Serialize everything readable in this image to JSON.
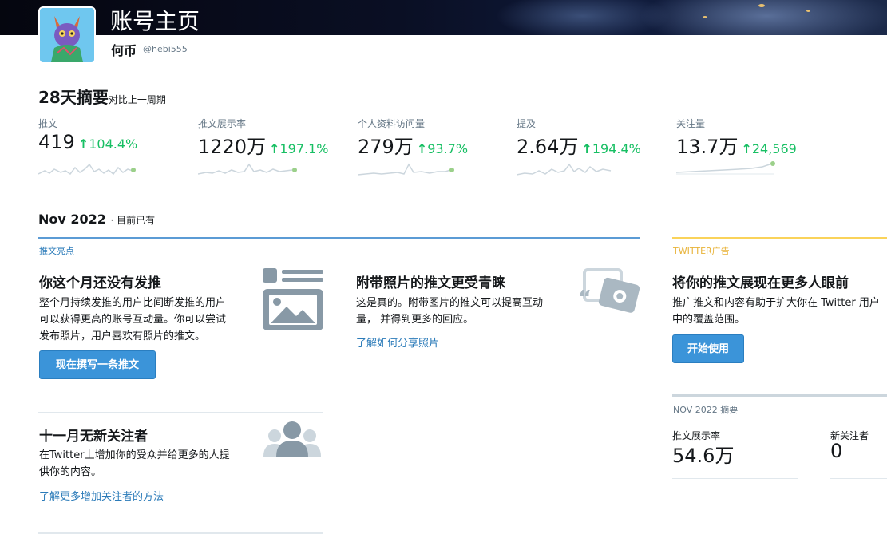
{
  "header": {
    "page_title": "账号主页",
    "user_name": "何币",
    "user_handle": "@hebi555"
  },
  "summary": {
    "title": "28天摘要",
    "subtitle": "对比上一周期",
    "stats": [
      {
        "label": "推文",
        "value": "419",
        "change": "104.4%"
      },
      {
        "label": "推文展示率",
        "value": "1220万",
        "change": "197.1%"
      },
      {
        "label": "个人资料访问量",
        "value": "279万",
        "change": "93.7%"
      },
      {
        "label": "提及",
        "value": "2.64万",
        "change": "194.4%"
      },
      {
        "label": "关注量",
        "value": "13.7万",
        "change": "24,569"
      }
    ]
  },
  "month": {
    "title": "Nov 2022",
    "subtitle": "· 目前已有"
  },
  "highlights": {
    "section_label": "推文亮点",
    "card1": {
      "title": "你这个月还没有发推",
      "text_lines": [
        "整个月持续发推的用户比间断发推的用户",
        "可以获得更高的账号互动量。你可以尝试",
        "发布照片，用户喜欢有照片的推文。"
      ],
      "button": "现在撰写一条推文"
    },
    "card2": {
      "title": "附带照片的推文更受青睐",
      "text_lines": [
        "这是真的。附带图片的推文可以提高互动",
        "量， 并得到更多的回应。"
      ],
      "link": "了解如何分享照片"
    },
    "card3": {
      "title": "十一月无新关注者",
      "text_lines": [
        "在Twitter上增加你的受众并给更多的人提",
        "供你的内容。"
      ],
      "link": "了解更多增加关注者的方法"
    }
  },
  "ads": {
    "section_label": "TWITTER广告",
    "title": "将你的推文展现在更多人眼前",
    "text_lines": [
      "推广推文和内容有助于扩大你在 Twitter 用户",
      "中的覆盖范围。"
    ],
    "button": "开始使用"
  },
  "nov_summary": {
    "label": "NOV 2022 摘要",
    "items": [
      {
        "label": "推文展示率",
        "value": "54.6万"
      },
      {
        "label": "新关注者",
        "value": "0"
      }
    ]
  },
  "colors": {
    "positive": "#17bf63",
    "link": "#2b7bb9",
    "button": "#3b94d9",
    "highlights_rule": "#5b9bd5",
    "ads_rule": "#fad35a"
  },
  "icons": {
    "arrow": "arrow-up-icon",
    "card1": "image-post-icon",
    "card2": "photo-tweet-icon",
    "card3": "followers-group-icon"
  }
}
